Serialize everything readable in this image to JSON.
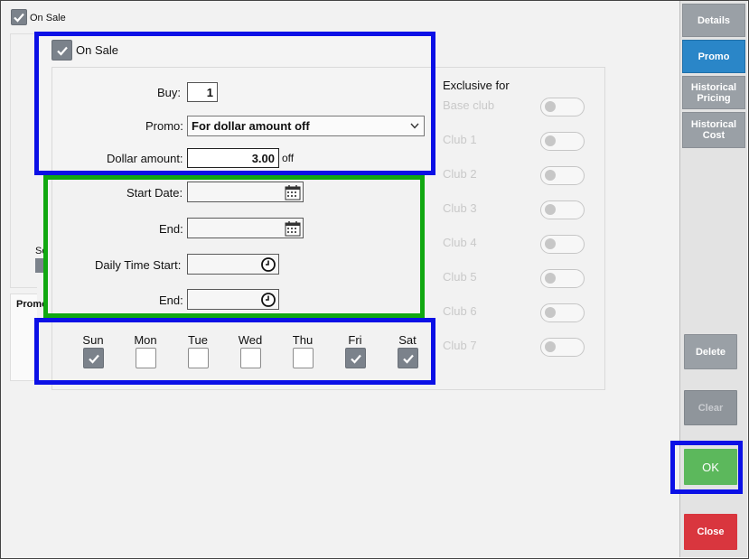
{
  "top_checkbox": {
    "label": "On Sale",
    "checked": true
  },
  "promo_panel": {
    "on_sale": {
      "label": "On Sale",
      "checked": true
    },
    "buy_label": "Buy:",
    "buy_value": "1",
    "promo_label": "Promo:",
    "promo_value": "For dollar amount off",
    "dollar_label": "Dollar amount:",
    "dollar_value": "3.00",
    "dollar_suffix": "off"
  },
  "schedule": {
    "start_date_label": "Start Date:",
    "end_date_label": "End:",
    "time_start_label": "Daily Time Start:",
    "time_end_label": "End:",
    "start_date": "",
    "end_date": "",
    "time_start": "",
    "time_end": ""
  },
  "days": [
    {
      "label": "Sun",
      "checked": true
    },
    {
      "label": "Mon",
      "checked": false
    },
    {
      "label": "Tue",
      "checked": false
    },
    {
      "label": "Wed",
      "checked": false
    },
    {
      "label": "Thu",
      "checked": false
    },
    {
      "label": "Fri",
      "checked": true
    },
    {
      "label": "Sat",
      "checked": true
    }
  ],
  "exclusive": {
    "title": "Exclusive for",
    "clubs": [
      "Base club",
      "Club 1",
      "Club 2",
      "Club 3",
      "Club 4",
      "Club 5",
      "Club 6",
      "Club 7"
    ]
  },
  "background_partial": {
    "se": "Se",
    "promo": "Promo"
  },
  "tabs": [
    {
      "label": "Details",
      "active": false
    },
    {
      "label": "Promo",
      "active": true
    },
    {
      "label": "Historical Pricing",
      "active": false
    },
    {
      "label": "Historical Cost",
      "active": false
    }
  ],
  "actions": {
    "delete": "Delete",
    "clear": "Clear",
    "ok": "OK",
    "close": "Close"
  },
  "colors": {
    "accent_blue": "#2a86c8",
    "ok_green": "#5cb85c",
    "close_red": "#d9363e",
    "disabled_grey": "#9aa0a6",
    "highlight_blue": "#0b10e6",
    "highlight_green": "#11a811"
  }
}
